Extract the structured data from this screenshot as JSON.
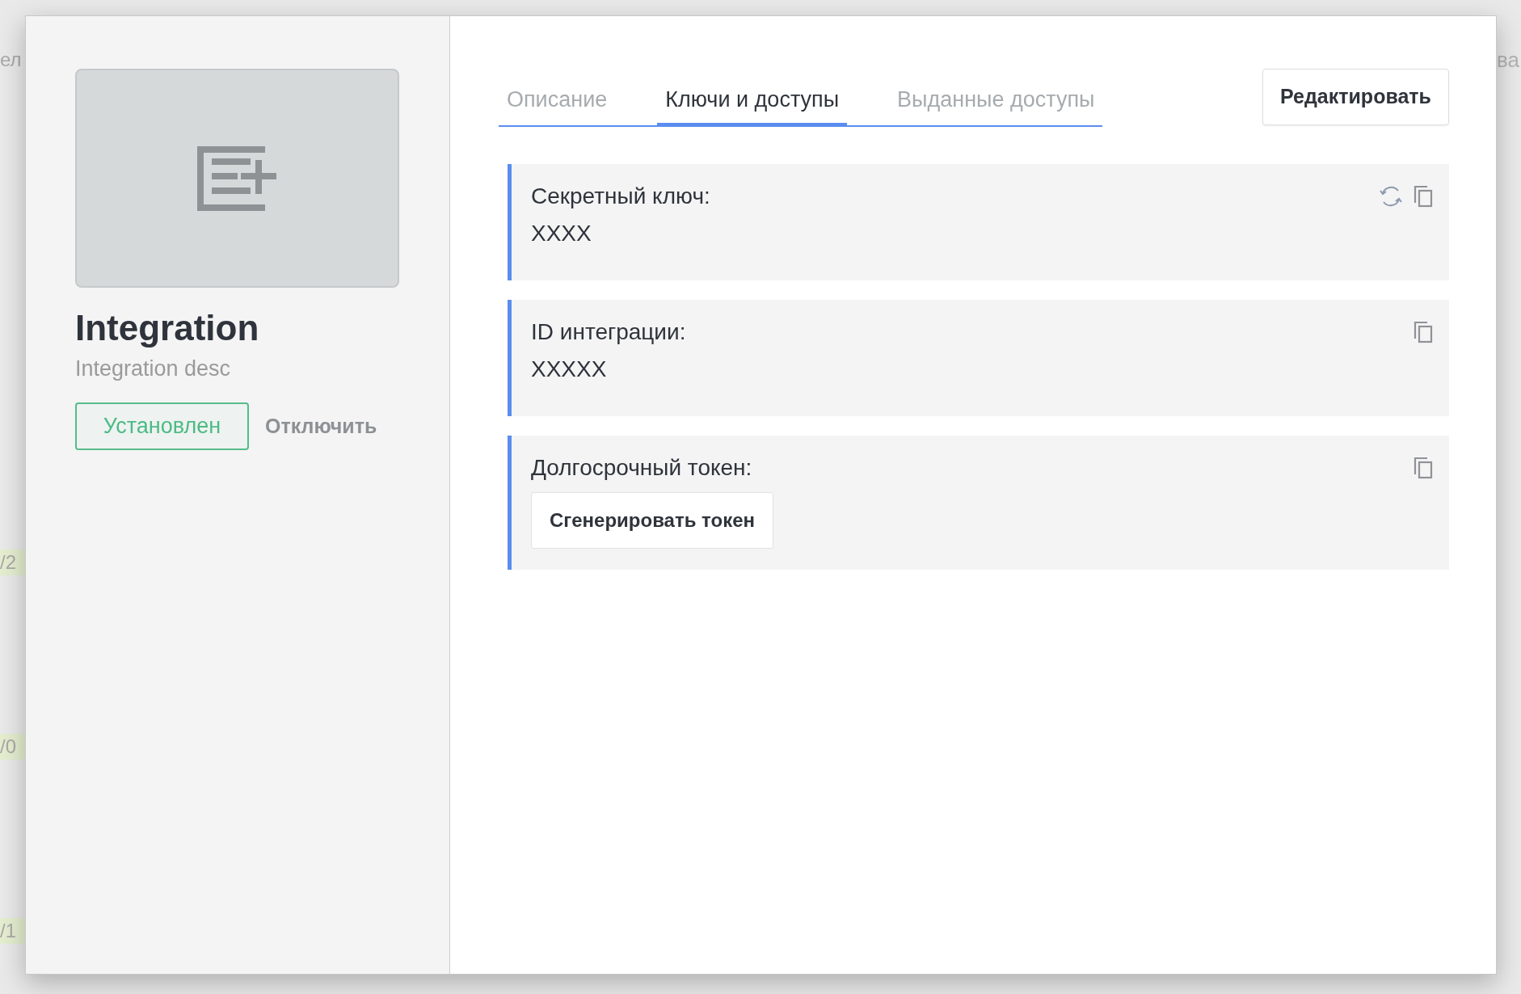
{
  "background": {
    "left_fragments": [
      "ел",
      "/2",
      "/0",
      "/1"
    ],
    "right_fragments": [
      "ва"
    ]
  },
  "integration": {
    "name": "Integration",
    "description": "Integration desc",
    "status": "Установлен",
    "disable_button": "Отключить"
  },
  "tabs": [
    {
      "label": "Описание",
      "selected": false
    },
    {
      "label": "Ключи и доступы",
      "selected": true
    },
    {
      "label": "Выданные доступы",
      "selected": false
    }
  ],
  "edit_button": "Редактировать",
  "fields": [
    {
      "kind": "value",
      "label": "Секретный ключ:",
      "value": "XXXX",
      "refreshable": true
    },
    {
      "kind": "value",
      "label": "ID интеграции:",
      "value": "XXXXX",
      "refreshable": false
    },
    {
      "kind": "action",
      "label": "Долгосрочный токен:",
      "button": "Сгенерировать токен"
    }
  ]
}
